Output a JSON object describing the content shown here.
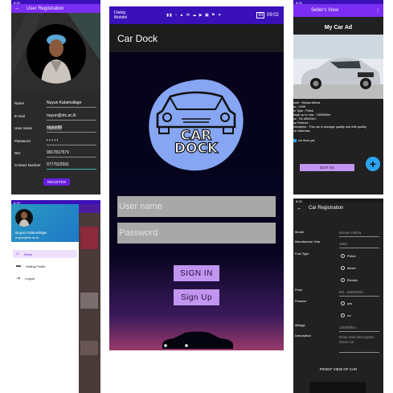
{
  "colors": {
    "purple_dark": "#3a10b8",
    "purple_app": "#7b2df2",
    "purple_button": "#c195f0",
    "dark_bg": "#212121",
    "login_bg": "#050318",
    "fab": "#2ba3f0",
    "logo_blue": "#86a5f2",
    "teal": "#39b4a3"
  },
  "register": {
    "status_time": "8:33",
    "title": "User Registration",
    "fields": [
      {
        "label": "Name",
        "value": "Nuyun Kalamullage"
      },
      {
        "label": "E-mail",
        "value": "nuyun@stc.ac.lk"
      },
      {
        "label": "User name",
        "value": "nuyun99"
      },
      {
        "label": "Password",
        "value": "• • • • •"
      },
      {
        "label": "NIC",
        "value": "991781757V"
      },
      {
        "label": "Contact Number",
        "value": "0777522591"
      }
    ],
    "register_label": "REGISTER"
  },
  "drawer": {
    "status_time": "8:33",
    "user_name": "Nuyun Kalamullage",
    "user_email": "nuyun@stc.ac.lk",
    "items": [
      {
        "label": "Home",
        "icon": "home-icon"
      },
      {
        "label": "Selling Profile",
        "icon": "car-icon"
      },
      {
        "label": "Logout",
        "icon": "logout-icon"
      }
    ]
  },
  "login": {
    "status_left": "Dialog Mobitel",
    "status_time": "09:02",
    "status_battery": "99",
    "app_title": "Car Dock",
    "logo_line1": "CAR",
    "logo_line2": "DOCK",
    "username_placeholder": "User name",
    "password_placeholder": "Password",
    "signin_label": "SIGN IN",
    "signup_label": "Sign Up"
  },
  "seller": {
    "status_time": "8:33",
    "title": "Seller's View",
    "ad_title": "My Car Ad",
    "details": [
      "odel : Nissan Altima",
      "ar : 1999",
      "el Type : Petrol",
      "llage up to now : 150000km",
      "ce : Rs 650000/=",
      "sy Finance :",
      "escription : This car in average quality and with quality",
      "ce materials."
    ],
    "checkbox_label": "mo fiees yat",
    "edit_label": "EDIT AD",
    "fab_label": "+"
  },
  "form": {
    "status_time": "8:33",
    "title": "Car Registration",
    "model_label": "Model",
    "model_value": "Nissan Altima",
    "year_label": "Manufacture Year",
    "year_value": "1992",
    "fuel_label": "Fuel Type",
    "fuel_options": [
      "Petrol",
      "diesel",
      "Electric"
    ],
    "price_label": "Price",
    "price_value": "RS . 6500000/=",
    "finance_label": "Finance",
    "finance_options": [
      "yes",
      "no"
    ],
    "mileage_label": "Millage",
    "mileage_value": "150000km",
    "description_label": "Description",
    "description_placeholder": "Enter brief description about car",
    "front_view_label": "FRONT VIEW OF CAR"
  }
}
